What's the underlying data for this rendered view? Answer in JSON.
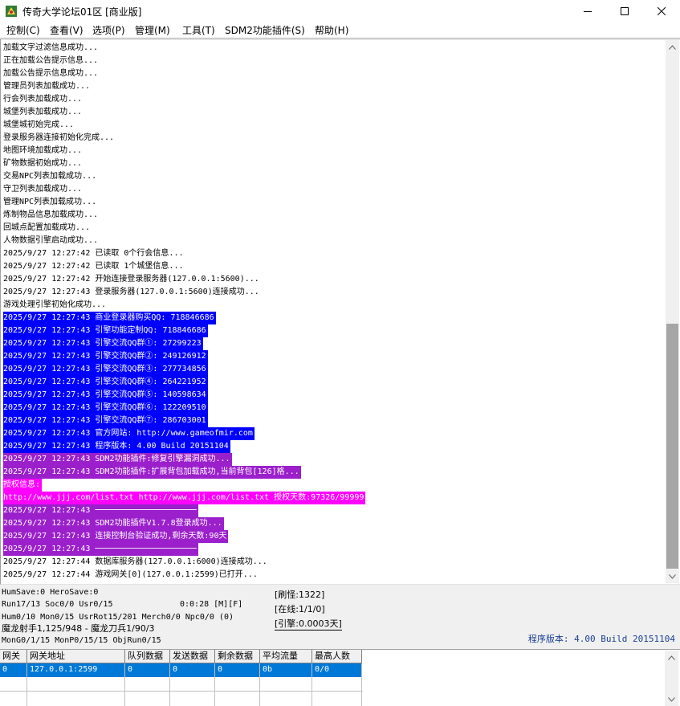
{
  "window": {
    "title": "传奇大学论坛01区 [商业版]"
  },
  "menu": {
    "items": [
      {
        "label": "控制(C)"
      },
      {
        "label": "查看(V)"
      },
      {
        "label": "选项(P)"
      },
      {
        "label": "管理(M)"
      },
      {
        "label": "工具(T)"
      },
      {
        "label": "SDM2功能插件(S)"
      },
      {
        "label": "帮助(H)"
      }
    ]
  },
  "log": {
    "lines": [
      {
        "text": "加载文字过滤信息成功...",
        "hl": ""
      },
      {
        "text": "正在加载公告提示信息...",
        "hl": ""
      },
      {
        "text": "加载公告提示信息成功...",
        "hl": ""
      },
      {
        "text": "管理员列表加载成功...",
        "hl": ""
      },
      {
        "text": "行会列表加载成功...",
        "hl": ""
      },
      {
        "text": "城堡列表加载成功...",
        "hl": ""
      },
      {
        "text": "城堡城初始完成...",
        "hl": ""
      },
      {
        "text": "登录服务器连接初始化完成...",
        "hl": ""
      },
      {
        "text": "地图环境加载成功...",
        "hl": ""
      },
      {
        "text": "矿物数据初始成功...",
        "hl": ""
      },
      {
        "text": "交易NPC列表加载成功...",
        "hl": ""
      },
      {
        "text": "守卫列表加载成功...",
        "hl": ""
      },
      {
        "text": "管理NPC列表加载成功...",
        "hl": ""
      },
      {
        "text": "炼制物品信息加载成功...",
        "hl": ""
      },
      {
        "text": "回城点配置加载成功...",
        "hl": ""
      },
      {
        "text": "人物数据引擎启动成功...",
        "hl": ""
      },
      {
        "text": "2025/9/27 12:27:42 已读取 0个行会信息...",
        "hl": ""
      },
      {
        "text": "2025/9/27 12:27:42 已读取 1个城堡信息...",
        "hl": ""
      },
      {
        "text": "2025/9/27 12:27:42 开始连接登录服务器(127.0.0.1:5600)...",
        "hl": ""
      },
      {
        "text": "2025/9/27 12:27:43 登录服务器(127.0.0.1:5600)连接成功...",
        "hl": ""
      },
      {
        "text": "游戏处理引擎初始化成功...",
        "hl": ""
      },
      {
        "text": "2025/9/27 12:27:43 商业登录器购买QQ: 718846686",
        "hl": "blue"
      },
      {
        "text": "2025/9/27 12:27:43 引擎功能定制QQ: 718846686",
        "hl": "blue"
      },
      {
        "text": "2025/9/27 12:27:43 引擎交流QQ群①: 27299223",
        "hl": "blue"
      },
      {
        "text": "2025/9/27 12:27:43 引擎交流QQ群②: 249126912",
        "hl": "blue"
      },
      {
        "text": "2025/9/27 12:27:43 引擎交流QQ群③: 277734856",
        "hl": "blue"
      },
      {
        "text": "2025/9/27 12:27:43 引擎交流QQ群④: 264221952",
        "hl": "blue"
      },
      {
        "text": "2025/9/27 12:27:43 引擎交流QQ群⑤: 140598634",
        "hl": "blue"
      },
      {
        "text": "2025/9/27 12:27:43 引擎交流QQ群⑥: 122209510",
        "hl": "blue"
      },
      {
        "text": "2025/9/27 12:27:43 引擎交流QQ群⑦: 286703001",
        "hl": "blue"
      },
      {
        "text": "2025/9/27 12:27:43 官方网站: http://www.gameofmir.com",
        "hl": "blue"
      },
      {
        "text": "2025/9/27 12:27:43 程序版本: 4.00 Build 20151104",
        "hl": "blue"
      },
      {
        "text": "2025/9/27 12:27:43 SDM2功能插件:修复引擎漏洞成功...",
        "hl": "purple"
      },
      {
        "text": "2025/9/27 12:27:43 SDM2功能插件:扩展背包加载成功,当前背包[126]格...",
        "hl": "purple"
      },
      {
        "text": "授权信息: ",
        "hl": "magenta"
      },
      {
        "text": "http://www.jjj.com/list.txt http://www.jjj.com/list.txt 授权天数:97326/99999",
        "hl": "magenta"
      },
      {
        "text": "2025/9/27 12:27:43 ─────────────────────",
        "hl": "purple"
      },
      {
        "text": "2025/9/27 12:27:43 SDM2功能插件V1.7.8登录成功...",
        "hl": "purple"
      },
      {
        "text": "2025/9/27 12:27:43 连接控制台验证成功,剩余天数:90天",
        "hl": "purple"
      },
      {
        "text": "2025/9/27 12:27:43 ─────────────────────",
        "hl": "purple"
      },
      {
        "text": "2025/9/27 12:27:44 数据库服务器(127.0.0.1:6000)连接成功...",
        "hl": ""
      },
      {
        "text": "2025/9/27 12:27:44 游戏网关[0](127.0.0.1:2599)已打开...",
        "hl": ""
      }
    ]
  },
  "status": {
    "line1": "HumSave:0 HeroSave:0",
    "line2": "Run17/13 Soc0/0 Usr0/15",
    "line2_time": "0:0:28 [M][F]",
    "line3": "Hum0/10 Mon0/15 UsrRot15/201 Merch0/0 Npc0/0 (0)",
    "line4": "魔龙射手1,125/948 - 魔龙刀兵1/90/3",
    "line5": "MonG0/1/15 MonP0/15/15 ObjRun0/15",
    "refresh": "[刷怪:1322]",
    "online": "[在线:1/1/0]",
    "engine": "[引擎:0.0003天]",
    "version": "程序版本: 4.00 Build 20151104"
  },
  "gateway_table": {
    "columns": [
      "网关",
      "网关地址",
      "队列数据",
      "发送数据",
      "剩余数据",
      "平均流量",
      "最高人数"
    ],
    "rows": [
      [
        "0",
        "127.0.0.1:2599",
        "0",
        "0",
        "0",
        "0b",
        "0/0"
      ]
    ]
  },
  "colors": {
    "highlight_blue": "#0000ff",
    "highlight_purple": "#9b20cc",
    "highlight_magenta": "#ff00ff",
    "selection": "#0078d7",
    "version_text": "#1a3e94"
  }
}
